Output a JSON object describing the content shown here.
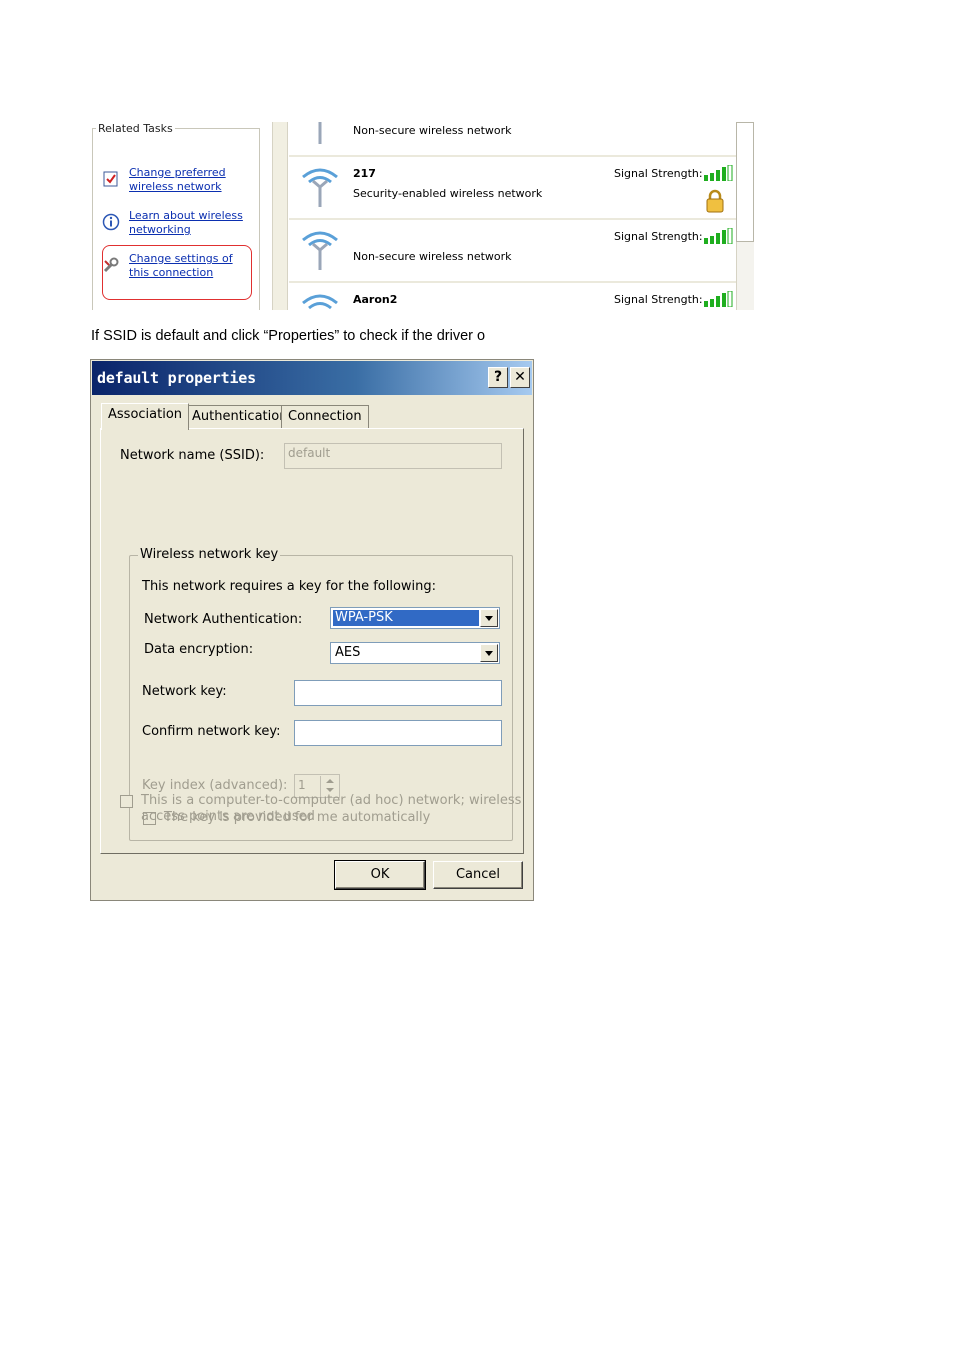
{
  "related_tasks": {
    "title": "Related Tasks",
    "items": [
      {
        "label": "Change preferred wireless network",
        "icon": "checklist-icon"
      },
      {
        "label": "Learn about wireless networking",
        "icon": "info-icon"
      },
      {
        "label": "Change settings of this connection",
        "icon": "wrench-icon"
      }
    ],
    "highlight_color": "#e03030"
  },
  "networks": [
    {
      "name": "",
      "security": "Non-secure wireless network",
      "signal_label": ""
    },
    {
      "name": "217",
      "security": "Security-enabled wireless network",
      "signal_label": "Signal Strength:",
      "signal_level": 0.8,
      "locked": true
    },
    {
      "name": "",
      "security": "Non-secure wireless network",
      "signal_label": "Signal Strength:",
      "signal_level": 0.8
    },
    {
      "name": "Aaron2",
      "security": "",
      "signal_label": "Signal Strength:",
      "signal_level": 0.8
    }
  ],
  "caption": "If SSID is default and click “Properties” to check if the driver o",
  "dialog": {
    "title": "default properties",
    "help_label": "?",
    "close_label": "✕",
    "tabs": [
      "Association",
      "Authentication",
      "Connection"
    ],
    "active_tab": "Association",
    "ssid_label": "Network name (SSID):",
    "ssid_value": "default",
    "key_group_title": "Wireless network key",
    "requires_text": "This network requires a key for the following:",
    "auth_label": "Network Authentication:",
    "auth_value": "WPA-PSK",
    "enc_label": "Data encryption:",
    "enc_value": "AES",
    "netkey_label": "Network key:",
    "netkey_value": "",
    "confirm_label": "Confirm network key:",
    "confirm_value": "",
    "keyindex_label": "Key index (advanced):",
    "keyindex_value": "1",
    "auto_key_label": "The key is provided for me automatically",
    "adhoc_line1": "This is a computer-to-computer (ad hoc) network; wireless",
    "adhoc_line2": "access points are not used",
    "ok_label": "OK",
    "cancel_label": "Cancel"
  },
  "colors": {
    "link": "#0b2fb0",
    "titlebar_start": "#0a246a",
    "titlebar_end": "#a6caf0",
    "selection": "#316ac5",
    "signal_green": "#1fae1f",
    "dialog_bg": "#ece9d8"
  }
}
